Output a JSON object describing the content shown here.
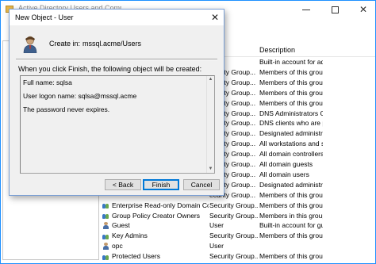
{
  "background_window": {
    "title": "Active Directory Users and Computers",
    "list": {
      "header_description": "Description",
      "rows": [
        {
          "name": "",
          "type": "",
          "description": "Built-in account for ad...",
          "icon": "user-icon"
        },
        {
          "name": "",
          "type": "ecurity Group...",
          "description": "Members of this group c...",
          "icon": "group-icon"
        },
        {
          "name": "",
          "type": "ecurity Group...",
          "description": "Members of this group c...",
          "icon": "group-icon"
        },
        {
          "name": "",
          "type": "ecurity Group...",
          "description": "Members of this group ...",
          "icon": "group-icon"
        },
        {
          "name": "",
          "type": "ecurity Group...",
          "description": "Members of this group c...",
          "icon": "group-icon"
        },
        {
          "name": "",
          "type": "ecurity Group...",
          "description": "DNS Administrators Gro...",
          "icon": "group-icon"
        },
        {
          "name": "",
          "type": "ecurity Group...",
          "description": "DNS clients who are per...",
          "icon": "group-icon"
        },
        {
          "name": "",
          "type": "ecurity Group...",
          "description": "Designated administrato...",
          "icon": "group-icon"
        },
        {
          "name": "",
          "type": "ecurity Group...",
          "description": "All workstations and ser...",
          "icon": "group-icon"
        },
        {
          "name": "",
          "type": "ecurity Group...",
          "description": "All domain controllers i...",
          "icon": "group-icon"
        },
        {
          "name": "",
          "type": "ecurity Group...",
          "description": "All domain guests",
          "icon": "group-icon"
        },
        {
          "name": "",
          "type": "ecurity Group...",
          "description": "All domain users",
          "icon": "group-icon"
        },
        {
          "name": "",
          "type": "ecurity Group...",
          "description": "Designated administrato...",
          "icon": "group-icon"
        },
        {
          "name": "",
          "type": "ecurity Group...",
          "description": "Members of this group c...",
          "icon": "group-icon"
        },
        {
          "name": "Enterprise Read-only Domain Con...",
          "type": "Security Group...",
          "description": "Members of this group ...",
          "icon": "group-icon"
        },
        {
          "name": "Group Policy Creator Owners",
          "type": "Security Group...",
          "description": "Members in this group c...",
          "icon": "group-icon"
        },
        {
          "name": "Guest",
          "type": "User",
          "description": "Built-in account for gue...",
          "icon": "user-icon"
        },
        {
          "name": "Key Admins",
          "type": "Security Group...",
          "description": "Members of this group ...",
          "icon": "group-icon"
        },
        {
          "name": "opc",
          "type": "User",
          "description": "",
          "icon": "user-icon"
        },
        {
          "name": "Protected Users",
          "type": "Security Group...",
          "description": "Members of this group ...",
          "icon": "group-icon"
        }
      ]
    }
  },
  "dialog": {
    "title": "New Object - User",
    "close_glyph": "✕",
    "create_in_label": "Create in:",
    "create_in_path": "mssql.acme/Users",
    "summary_intro": "When you click Finish, the following object will be created:",
    "summary": {
      "full_name": "Full name: sqlsa",
      "logon_name": "User logon name: sqlsa@mssql.acme",
      "password_note": "The password never expires."
    },
    "buttons": {
      "back": "< Back",
      "finish": "Finish",
      "cancel": "Cancel"
    }
  },
  "colors": {
    "accent": "#0078d7",
    "dialog_bg": "#f0f0f0",
    "window_border": "#1e90ff"
  }
}
